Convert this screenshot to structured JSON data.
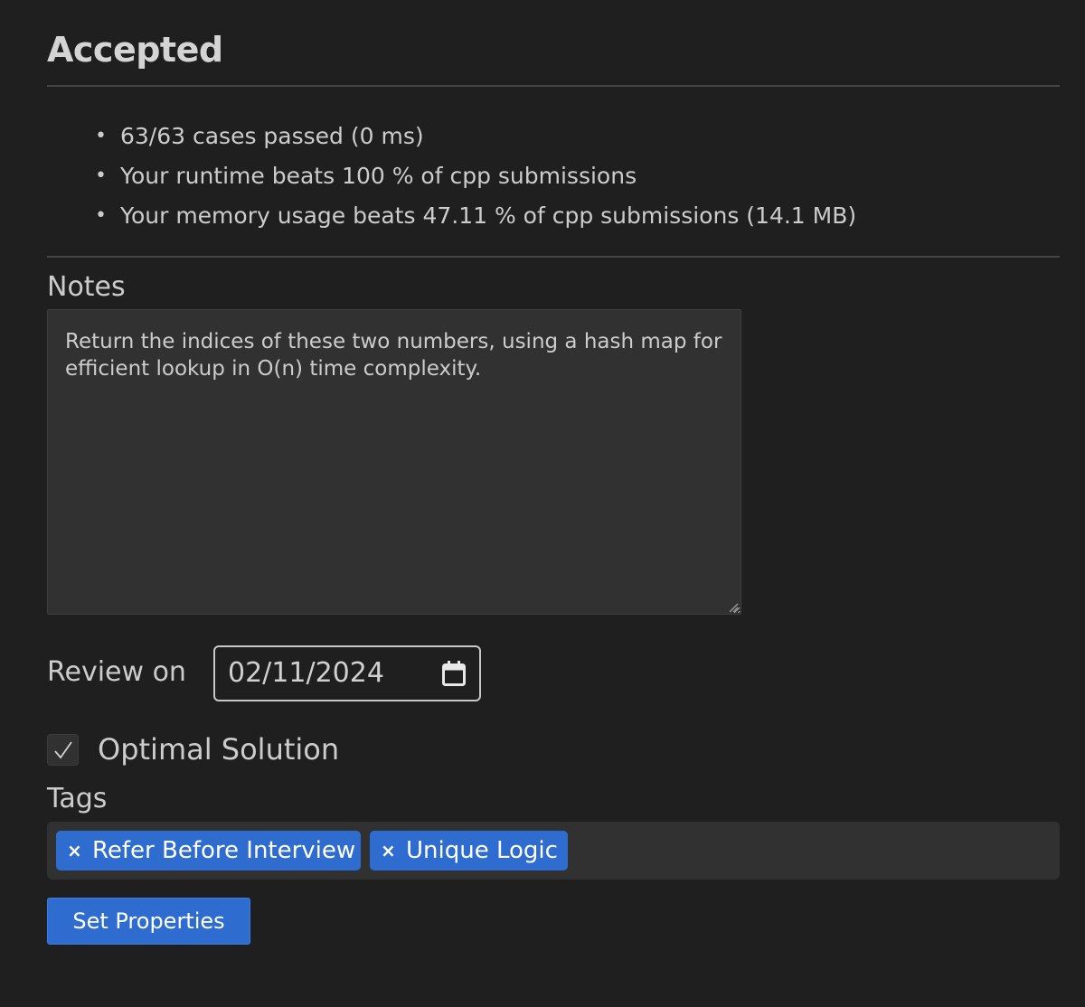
{
  "result": {
    "status": "Accepted",
    "details": [
      "63/63 cases passed (0 ms)",
      "Your runtime beats 100 % of cpp submissions",
      "Your memory usage beats 47.11 % of cpp submissions (14.1 MB)"
    ]
  },
  "notes": {
    "label": "Notes",
    "value": "Return the indices of these two numbers, using a hash map for efficient lookup in O(n) time complexity."
  },
  "review": {
    "label": "Review on",
    "date": "02/11/2024"
  },
  "optimal": {
    "label": "Optimal Solution",
    "checked": true
  },
  "tags": {
    "label": "Tags",
    "items": [
      {
        "label": "Refer Before Interview",
        "remove_glyph": "×"
      },
      {
        "label": "Unique Logic",
        "remove_glyph": "×"
      }
    ]
  },
  "actions": {
    "set_properties_label": "Set Properties"
  },
  "icons": {
    "bullet": "•",
    "calendar": "calendar-icon",
    "check": "check-icon",
    "resize": "resize-grip-icon"
  },
  "colors": {
    "background": "#1f1f1f",
    "panel": "#313131",
    "accent": "#2f6ccf",
    "text": "#cccccc"
  }
}
